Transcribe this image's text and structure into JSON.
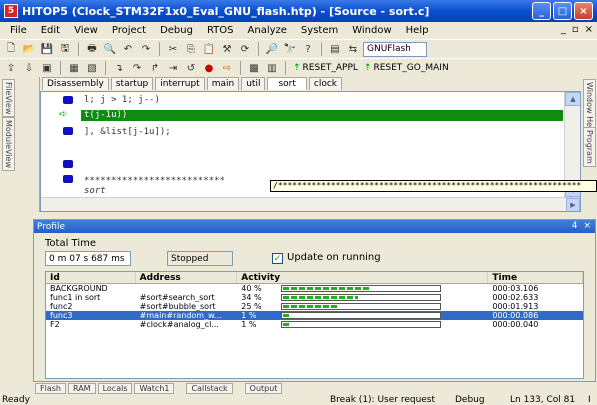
{
  "window": {
    "title": "HITOP5 (Clock_STM32F1x0_Eval_GNU_flash.htp) - [Source - sort.c]",
    "icon_label": "5",
    "buttons": [
      "_",
      "□",
      "×"
    ]
  },
  "menu": {
    "items": [
      "File",
      "Edit",
      "View",
      "Project",
      "Debug",
      "RTOS",
      "Analyze",
      "System",
      "Window",
      "Help"
    ],
    "mdi_buttons": [
      "_",
      "▫",
      "×"
    ]
  },
  "toolbar": {
    "target_combo": "GNUFlash",
    "reset_appl": "RESET_APPL",
    "reset_go_main": "RESET_GO_MAIN"
  },
  "side_tabs": {
    "left": [
      "FileView",
      "ModuleView"
    ],
    "right": [
      "Window Helper",
      "Program"
    ]
  },
  "editor": {
    "tabs": [
      "Disassembly",
      "startup",
      "interrupt",
      "main",
      "util",
      "sort",
      "clock"
    ],
    "active_tab": "sort",
    "lines": [
      "l; j > 1; j--)",
      "t(j-1u))",
      "], &list[j-1u]);",
      "**************************",
      "sort"
    ],
    "tooltip": "/***************************************************************"
  },
  "profile": {
    "title": "Profile",
    "header_buttons": [
      "4",
      "×"
    ],
    "total_time_label": "Total Time",
    "total_time_value": "0 m 07 s 687 ms",
    "status": "Stopped",
    "update_label": "Update on running",
    "update_checked": true,
    "columns": [
      "Id",
      "Address",
      "Activity",
      "Time"
    ],
    "rows": [
      {
        "id": "BACKGROUND",
        "address": "",
        "pct": "40 %",
        "activity": 0.4,
        "time": "000:03.106"
      },
      {
        "id": "func1 in sort",
        "address": "#sort#search_sort",
        "pct": "34 %",
        "activity": 0.34,
        "time": "000:02.633"
      },
      {
        "id": "func2",
        "address": "#sort#bubble_sort",
        "pct": "25 %",
        "activity": 0.25,
        "time": "000:01.913"
      },
      {
        "id": "func3",
        "address": "#main#random_w...",
        "pct": "1 %",
        "activity": 0.01,
        "time": "000:00.086",
        "selected": true
      },
      {
        "id": "F2",
        "address": "#clock#analog_cl...",
        "pct": "1 %",
        "activity": 0.01,
        "time": "000:00.040"
      }
    ]
  },
  "bottom_tabs": [
    "Flash",
    "RAM",
    "Locals",
    "Watch1",
    "Callstack",
    "Output"
  ],
  "statusbar": {
    "ready": "Ready",
    "break": "Break (1): User request",
    "mode": "Debug",
    "position": "Ln 133, Col 81",
    "extra": "I"
  }
}
